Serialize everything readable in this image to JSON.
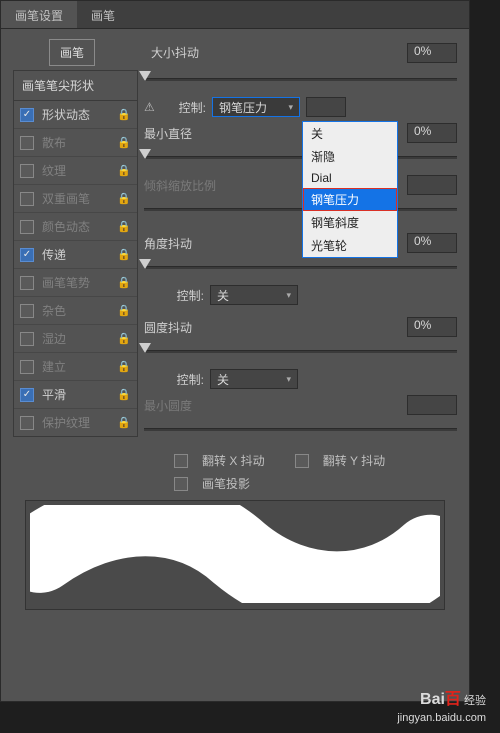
{
  "tabs": {
    "settings": "画笔设置",
    "brushes": "画笔"
  },
  "brushBtn": "画笔",
  "sidebar": {
    "header": "画笔笔尖形状",
    "items": [
      {
        "label": "形状动态",
        "checked": true
      },
      {
        "label": "散布",
        "checked": false
      },
      {
        "label": "纹理",
        "checked": false
      },
      {
        "label": "双重画笔",
        "checked": false
      },
      {
        "label": "颜色动态",
        "checked": false
      },
      {
        "label": "传递",
        "checked": true
      },
      {
        "label": "画笔笔势",
        "checked": false
      },
      {
        "label": "杂色",
        "checked": false
      },
      {
        "label": "湿边",
        "checked": false
      },
      {
        "label": "建立",
        "checked": false
      },
      {
        "label": "平滑",
        "checked": true
      },
      {
        "label": "保护纹理",
        "checked": false
      }
    ]
  },
  "main": {
    "sizeJitter": "大小抖动",
    "control": "控制:",
    "minDiameter": "最小直径",
    "tiltScale": "倾斜缩放比例",
    "angleJitter": "角度抖动",
    "roundnessJitter": "圆度抖动",
    "minRoundness": "最小圆度",
    "selControl1": "钢笔压力",
    "selOff": "关",
    "flipX": "翻转 X 抖动",
    "flipY": "翻转 Y 抖动",
    "brushProj": "画笔投影",
    "pct0": "0%"
  },
  "dropdown": {
    "items": [
      "关",
      "渐隐",
      "Dial",
      "钢笔压力",
      "钢笔斜度",
      "光笔轮"
    ],
    "highlighted": 3
  },
  "watermark": {
    "brand1": "Bai",
    "brand2": "百",
    "brand3": "经验",
    "url": "jingyan.baidu.com"
  }
}
